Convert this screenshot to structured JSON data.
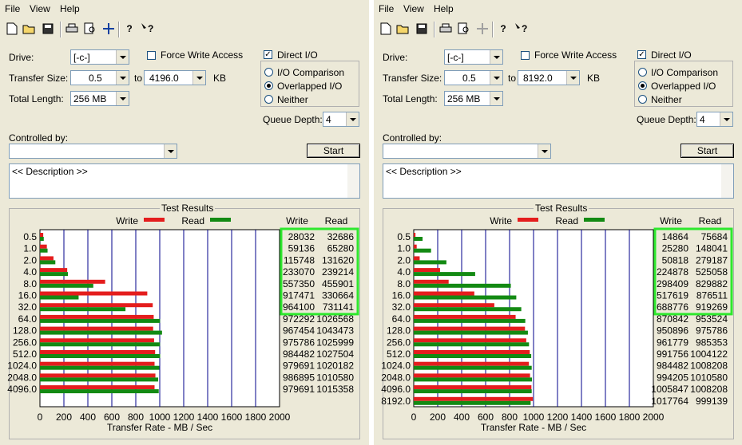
{
  "menu": {
    "file": "File",
    "view": "View",
    "help": "Help"
  },
  "labels": {
    "drive": "Drive:",
    "transfer_size": "Transfer Size:",
    "to": "to",
    "kb": "KB",
    "total_length": "Total Length:",
    "force_write": "Force Write Access",
    "direct_io": "Direct I/O",
    "io_comparison": "I/O Comparison",
    "overlapped_io": "Overlapped I/O",
    "neither": "Neither",
    "queue_depth": "Queue Depth:",
    "controlled_by": "Controlled by:",
    "start": "Start",
    "description": "<< Description >>",
    "test_results": "Test Results",
    "write": "Write",
    "read": "Read",
    "x_axis_label": "Transfer Rate - MB / Sec"
  },
  "colors": {
    "write": "#e41d1d",
    "read": "#138a13",
    "grid": "#00008b",
    "highlight": "#2ee82e"
  },
  "chart_data": [
    {
      "type": "bar",
      "orientation": "horizontal",
      "drive": "[-c-]",
      "transfer_size_from": "0.5",
      "transfer_size_to": "4196.0",
      "total_length": "256 MB",
      "queue_depth": "4",
      "direct_io": true,
      "force_write_access": false,
      "selected_mode": "Overlapped I/O",
      "xlabel": "Transfer Rate - MB / Sec",
      "xlim": [
        0,
        2000
      ],
      "xticks": [
        "0",
        "200",
        "400",
        "600",
        "800",
        "1000",
        "1200",
        "1400",
        "1600",
        "1800",
        "2000"
      ],
      "categories": [
        "0.5",
        "1.0",
        "2.0",
        "4.0",
        "8.0",
        "16.0",
        "32.0",
        "64.0",
        "128.0",
        "256.0",
        "512.0",
        "1024.0",
        "2048.0",
        "4096.0"
      ],
      "series": [
        {
          "name": "Write",
          "values": [
            28032,
            59136,
            115748,
            233070,
            557350,
            917471,
            964100,
            972292,
            967454,
            975786,
            984482,
            979691,
            986895,
            979691
          ]
        },
        {
          "name": "Read",
          "values": [
            32686,
            65280,
            131620,
            239214,
            455901,
            330664,
            731141,
            1026568,
            1043473,
            1025999,
            1027504,
            1020182,
            1010580,
            1015358
          ]
        }
      ],
      "highlighted_rows": 7
    },
    {
      "type": "bar",
      "orientation": "horizontal",
      "drive": "[-c-]",
      "transfer_size_from": "0.5",
      "transfer_size_to": "8192.0",
      "total_length": "256 MB",
      "queue_depth": "4",
      "direct_io": true,
      "force_write_access": false,
      "selected_mode": "Overlapped I/O",
      "xlabel": "Transfer Rate - MB / Sec",
      "xlim": [
        0,
        2000
      ],
      "xticks": [
        "0",
        "200",
        "400",
        "600",
        "800",
        "1000",
        "1200",
        "1400",
        "1600",
        "1800",
        "2000"
      ],
      "categories": [
        "0.5",
        "1.0",
        "2.0",
        "4.0",
        "8.0",
        "16.0",
        "32.0",
        "64.0",
        "128.0",
        "256.0",
        "512.0",
        "1024.0",
        "2048.0",
        "4096.0",
        "8192.0"
      ],
      "series": [
        {
          "name": "Write",
          "values": [
            14864,
            25280,
            50818,
            224878,
            298409,
            517619,
            688776,
            870842,
            950896,
            961779,
            991756,
            984482,
            994205,
            1005847,
            1017764
          ]
        },
        {
          "name": "Read",
          "values": [
            75684,
            148041,
            279187,
            525058,
            829882,
            876511,
            919269,
            953524,
            975786,
            985353,
            1004122,
            1008208,
            1010580,
            1008208,
            999139
          ]
        }
      ],
      "highlighted_rows": 7
    }
  ]
}
